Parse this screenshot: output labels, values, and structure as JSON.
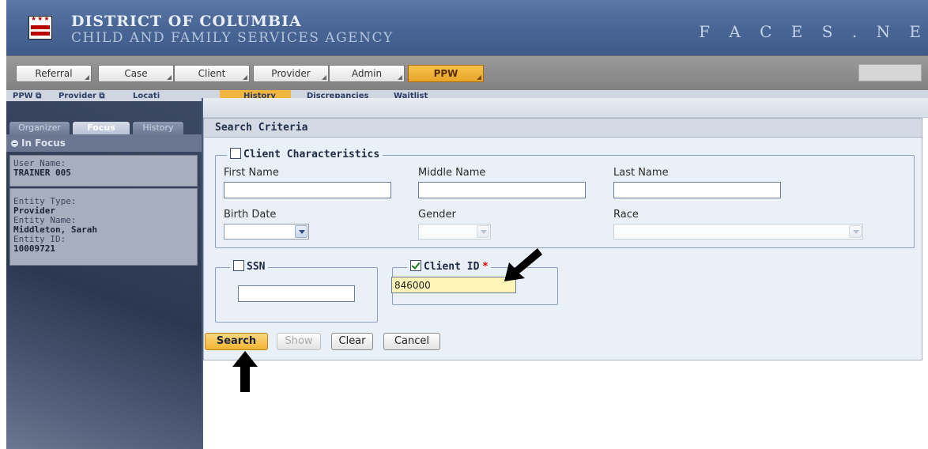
{
  "header": {
    "org_line1": "DISTRICT OF COLUMBIA",
    "org_line2": "CHILD AND FAMILY SERVICES AGENCY",
    "app_name": "F A C E S . N E",
    "flag_stars": "★★★"
  },
  "menu": {
    "items": [
      {
        "label": "Referral"
      },
      {
        "label": "Case"
      },
      {
        "label": "Client"
      },
      {
        "label": "Provider"
      },
      {
        "label": "Admin"
      },
      {
        "label": "PPW",
        "active": true
      }
    ]
  },
  "breadcrumb": {
    "items": [
      "PPW ⧉",
      "Provider ⧉",
      "Locati",
      "History",
      "Discrepancies",
      "Waitlist"
    ]
  },
  "left_panel": {
    "tabs": [
      "Organizer",
      "Focus",
      "History"
    ],
    "active_tab": "Focus",
    "section_title": "In Focus",
    "user_name_label": "User Name:",
    "user_name_value": "TRAINER 005",
    "entity_type_label": "Entity Type:",
    "entity_type_value": "Provider",
    "entity_name_label": "Entity Name:",
    "entity_name_value": "Middleton, Sarah",
    "entity_id_label": "Entity ID:",
    "entity_id_value": "10009721"
  },
  "search_criteria": {
    "header": "Search Criteria",
    "client_characteristics": {
      "legend": "Client Characteristics",
      "checked": false,
      "first_name_label": "First Name",
      "first_name_value": "",
      "middle_name_label": "Middle Name",
      "middle_name_value": "",
      "last_name_label": "Last Name",
      "last_name_value": "",
      "birth_date_label": "Birth Date",
      "gender_label": "Gender",
      "race_label": "Race"
    },
    "ssn": {
      "legend": "SSN",
      "checked": false,
      "value": ""
    },
    "client_id": {
      "legend": "Client ID",
      "required_mark": "*",
      "checked": true,
      "value": "846000"
    }
  },
  "buttons": {
    "search": "Search",
    "show": "Show",
    "clear": "Clear",
    "cancel": "Cancel"
  },
  "colors": {
    "banner": "#4a6797",
    "active_menu": "#e8a52a",
    "primary_button": "#f2b431",
    "highlight_input": "#fdf4b8"
  }
}
